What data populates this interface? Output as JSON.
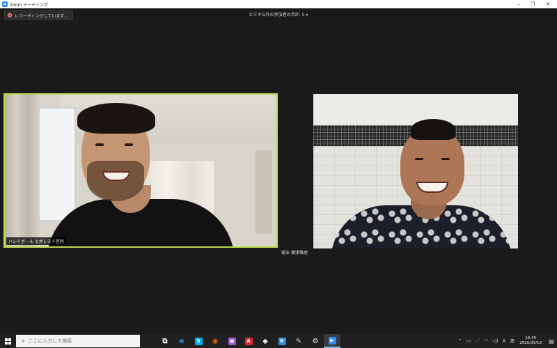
{
  "window": {
    "title": "Zoom ミーティング",
    "minimize": "–",
    "maximize": "❐",
    "close": "✕"
  },
  "meeting": {
    "recording_label": "レコーディングしています...",
    "participants_label": "ビデオ以外の参加者の合計: 5 ▾",
    "left_participant_name": "ハンドボール 土井レミイ杏利",
    "right_participant_name": "競泳 瀬浦慎理",
    "active_speaker_border_color": "#b8d94b"
  },
  "taskbar": {
    "search_placeholder": "ここに入力して検索",
    "apps": [
      {
        "name": "task-view",
        "glyph": "⧉",
        "color": "#ffffff"
      },
      {
        "name": "edge",
        "glyph": "e",
        "color": "#3a8ee6"
      },
      {
        "name": "skype",
        "glyph": "S",
        "color": "#00aff0"
      },
      {
        "name": "firefox",
        "glyph": "◉",
        "color": "#e66000"
      },
      {
        "name": "photos",
        "glyph": "▣",
        "color": "#9b59d0"
      },
      {
        "name": "acrobat",
        "glyph": "A",
        "color": "#d9282f"
      },
      {
        "name": "app-cube",
        "glyph": "◆",
        "color": "#e8e8e8"
      },
      {
        "name": "app-k",
        "glyph": "K",
        "color": "#2c8fd6"
      },
      {
        "name": "app-pen",
        "glyph": "✎",
        "color": "#cfcfcf"
      },
      {
        "name": "settings",
        "glyph": "⚙",
        "color": "#e8e8e8"
      },
      {
        "name": "zoom",
        "glyph": "▶",
        "color": "#2d8cff"
      }
    ],
    "clock_time": "16:45",
    "clock_date": "2020/05/13"
  }
}
